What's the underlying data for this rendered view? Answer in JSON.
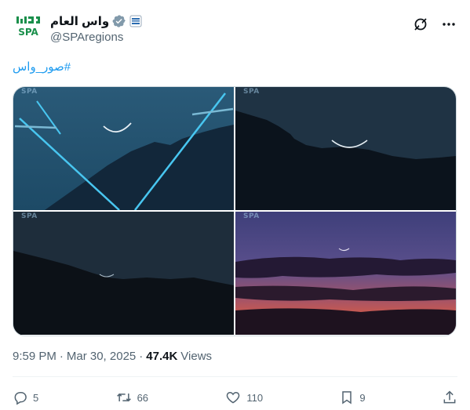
{
  "author": {
    "display_name": "واس العام",
    "handle": "@SPAregions",
    "avatar_logo_text": "SPA"
  },
  "top_actions": {
    "grok_icon": "grok-icon",
    "more_icon": "more-icon"
  },
  "tweet": {
    "hashtag": "#صور_واس"
  },
  "media": {
    "watermark": "SPA",
    "images": [
      {
        "label": "Crescent moon over mountain with street lamps"
      },
      {
        "label": "Crescent moon over dark ridge"
      },
      {
        "label": "Faint crescent over dark hills"
      },
      {
        "label": "Crescent above sunset clouds"
      }
    ]
  },
  "meta": {
    "time": "9:59 PM",
    "separator": "·",
    "date": "Mar 30, 2025",
    "separator2": "·",
    "views_count": "47.4K",
    "views_label": "Views"
  },
  "actions": {
    "replies": "5",
    "reposts": "66",
    "likes": "110",
    "bookmarks": "9"
  },
  "colors": {
    "accent": "#1d9bf0",
    "secondary_text": "#536471",
    "verified": "#829aab",
    "logo_green": "#1a8f4b"
  }
}
